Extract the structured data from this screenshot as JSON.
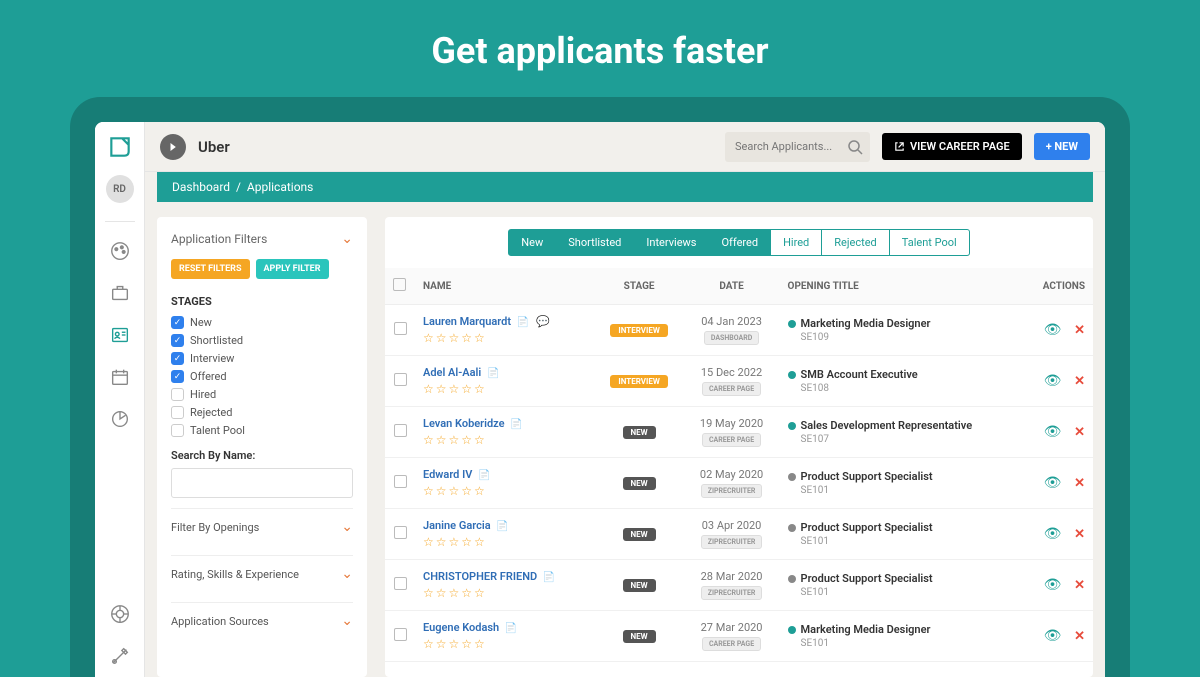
{
  "hero": {
    "title": "Get applicants faster"
  },
  "topbar": {
    "org": "Uber",
    "search_placeholder": "Search Applicants...",
    "career_btn": "VIEW CAREER PAGE",
    "new_btn": "+ NEW"
  },
  "avatar_initials": "RD",
  "breadcrumb": {
    "root": "Dashboard",
    "current": "Applications"
  },
  "filters": {
    "title": "Application Filters",
    "reset": "RESET FILTERS",
    "apply": "APPLY FILTER",
    "stages_label": "STAGES",
    "stages": [
      {
        "label": "New",
        "checked": true
      },
      {
        "label": "Shortlisted",
        "checked": true
      },
      {
        "label": "Interview",
        "checked": true
      },
      {
        "label": "Offered",
        "checked": true
      },
      {
        "label": "Hired",
        "checked": false
      },
      {
        "label": "Rejected",
        "checked": false
      },
      {
        "label": "Talent Pool",
        "checked": false
      }
    ],
    "search_name_label": "Search By Name:",
    "collapsibles": [
      "Filter By Openings",
      "Rating, Skills & Experience",
      "Application Sources"
    ]
  },
  "stage_tabs": [
    {
      "label": "New",
      "active": true
    },
    {
      "label": "Shortlisted",
      "active": true
    },
    {
      "label": "Interviews",
      "active": true
    },
    {
      "label": "Offered",
      "active": true
    },
    {
      "label": "Hired",
      "active": false
    },
    {
      "label": "Rejected",
      "active": false
    },
    {
      "label": "Talent Pool",
      "active": false
    }
  ],
  "table": {
    "headers": {
      "name": "NAME",
      "stage": "STAGE",
      "date": "DATE",
      "opening": "OPENING TITLE",
      "actions": "ACTIONS"
    },
    "rows": [
      {
        "name": "Lauren Marquardt",
        "has_chat": true,
        "stage": "INTERVIEW",
        "stage_class": "pill-interview",
        "date": "04 Jan 2023",
        "source": "DASHBOARD",
        "dot": "dot-green",
        "opening": "Marketing Media Designer",
        "code": "SE109"
      },
      {
        "name": "Adel Al-Aali",
        "has_chat": false,
        "stage": "INTERVIEW",
        "stage_class": "pill-interview",
        "date": "15 Dec 2022",
        "source": "CAREER PAGE",
        "dot": "dot-green",
        "opening": "SMB Account Executive",
        "code": "SE108"
      },
      {
        "name": "Levan Koberidze",
        "has_chat": false,
        "stage": "NEW",
        "stage_class": "pill-new",
        "date": "19 May 2020",
        "source": "CAREER PAGE",
        "dot": "dot-green",
        "opening": "Sales Development Representative",
        "code": "SE107"
      },
      {
        "name": "Edward IV",
        "has_chat": false,
        "stage": "NEW",
        "stage_class": "pill-new",
        "date": "02 May 2020",
        "source": "ZIPRECRUITER",
        "dot": "dot-grey",
        "opening": "Product Support Specialist",
        "code": "SE101"
      },
      {
        "name": "Janine Garcia",
        "has_chat": false,
        "stage": "NEW",
        "stage_class": "pill-new",
        "date": "03 Apr 2020",
        "source": "ZIPRECRUITER",
        "dot": "dot-grey",
        "opening": "Product Support Specialist",
        "code": "SE101"
      },
      {
        "name": "CHRISTOPHER FRIEND",
        "has_chat": false,
        "stage": "NEW",
        "stage_class": "pill-new",
        "date": "28 Mar 2020",
        "source": "ZIPRECRUITER",
        "dot": "dot-grey",
        "opening": "Product Support Specialist",
        "code": "SE101"
      },
      {
        "name": "Eugene Kodash",
        "has_chat": false,
        "stage": "NEW",
        "stage_class": "pill-new",
        "date": "27 Mar 2020",
        "source": "CAREER PAGE",
        "dot": "dot-green",
        "opening": "Marketing Media Designer",
        "code": "SE101"
      }
    ]
  }
}
